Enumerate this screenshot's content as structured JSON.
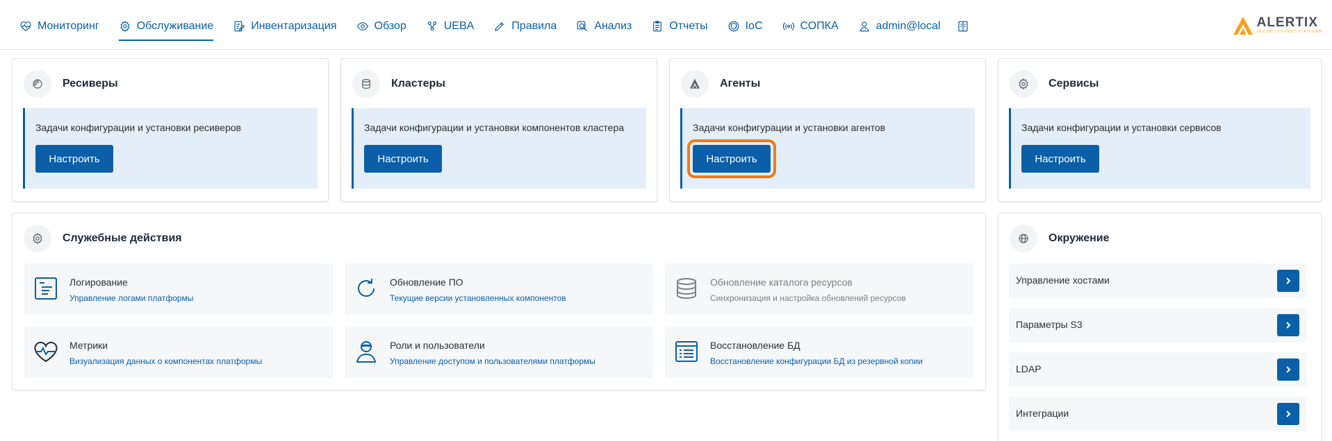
{
  "nav": {
    "items": [
      {
        "label": "Мониторинг",
        "icon": "heart-pulse-icon"
      },
      {
        "label": "Обслуживание",
        "icon": "gear-icon",
        "active": true
      },
      {
        "label": "Инвентаризация",
        "icon": "edit-list-icon"
      },
      {
        "label": "Обзор",
        "icon": "eye-icon"
      },
      {
        "label": "UEBA",
        "icon": "users-network-icon"
      },
      {
        "label": "Правила",
        "icon": "pencil-icon"
      },
      {
        "label": "Анализ",
        "icon": "magnifier-icon"
      },
      {
        "label": "Отчеты",
        "icon": "clipboard-icon"
      },
      {
        "label": "IoC",
        "icon": "shield-icon"
      },
      {
        "label": "СОПКА",
        "icon": "broadcast-icon"
      },
      {
        "label": "admin@local",
        "icon": "user-icon"
      }
    ],
    "extra_icon": "book-panel-icon"
  },
  "brand": {
    "name": "ALERTIX",
    "tagline": "SECURITY EVENT PLATFORM"
  },
  "config_cards": [
    {
      "title": "Ресиверы",
      "icon": "receiver-icon",
      "description": "Задачи конфигурации и установки ресиверов",
      "button": "Настроить"
    },
    {
      "title": "Кластеры",
      "icon": "database-icon",
      "description": "Задачи конфигурации и установки компонентов кластера",
      "button": "Настроить"
    },
    {
      "title": "Агенты",
      "icon": "agent-icon",
      "description": "Задачи конфигурации и установки агентов",
      "button": "Настроить"
    },
    {
      "title": "Сервисы",
      "icon": "gear-icon",
      "description": "Задачи конфигурации и установки сервисов",
      "button": "Настроить"
    }
  ],
  "service_actions": {
    "title": "Служебные действия",
    "icon": "gear-icon",
    "items": [
      {
        "title": "Логирование",
        "subtitle": "Управление логами платформы",
        "icon": "log-list-icon"
      },
      {
        "title": "Обновление ПО",
        "subtitle": "Текущие версии установленных компонентов",
        "icon": "refresh-icon"
      },
      {
        "title": "Обновление каталога ресурсов",
        "subtitle": "Синхронизация и настройка обновлений ресурсов",
        "icon": "database-stack-icon",
        "disabled": true
      },
      {
        "title": "Метрики",
        "subtitle": "Визуализация данных о компонентах платформы",
        "icon": "heart-metrics-icon"
      },
      {
        "title": "Роли и пользователи",
        "subtitle": "Управление доступом и пользователями платформы",
        "icon": "user-role-icon"
      },
      {
        "title": "Восстановление БД",
        "subtitle": "Восстановление конфигурации БД из резервной копии",
        "icon": "restore-list-icon"
      }
    ]
  },
  "environment": {
    "title": "Окружение",
    "icon": "globe-icon",
    "items": [
      {
        "label": "Управление хостами"
      },
      {
        "label": "Параметры S3"
      },
      {
        "label": "LDAP"
      },
      {
        "label": "Интеграции"
      }
    ]
  },
  "colors": {
    "accent": "#0a5fa8",
    "highlight": "#f07b16",
    "panel": "#e4eef8",
    "brand_orange": "#f6a21a"
  }
}
